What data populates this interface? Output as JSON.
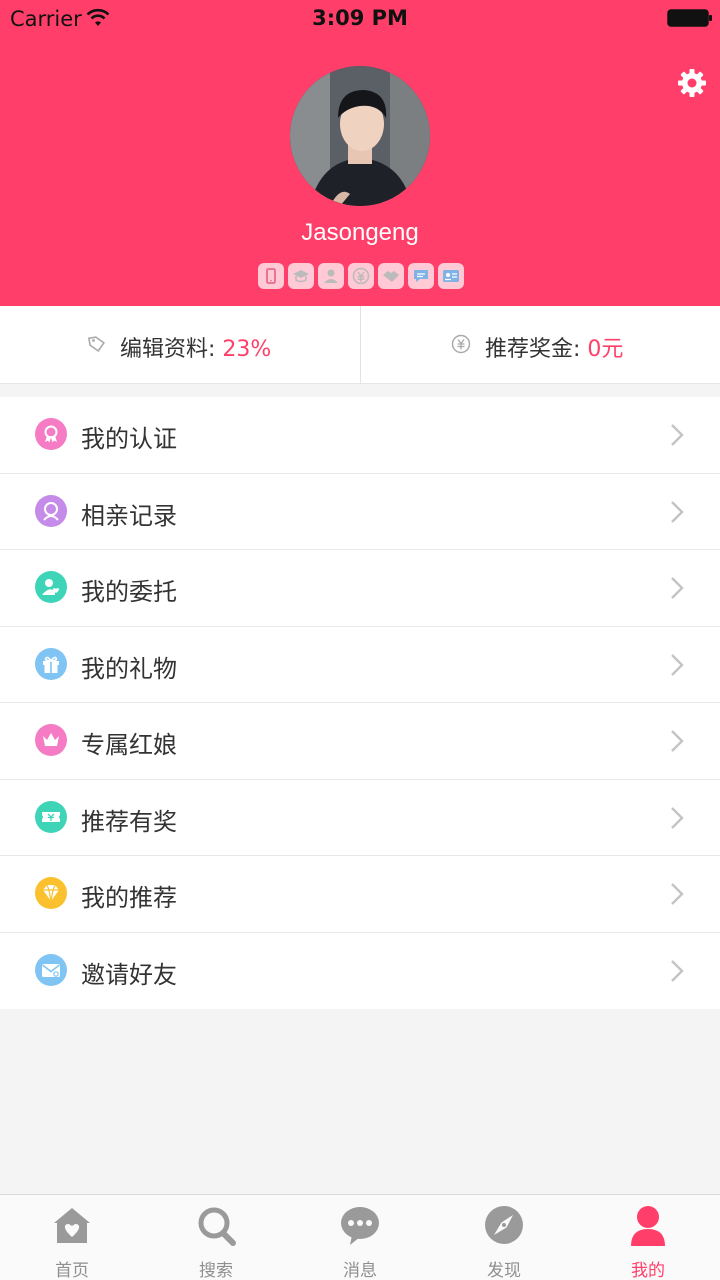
{
  "status_bar": {
    "carrier": "Carrier",
    "time": "3:09 PM"
  },
  "profile": {
    "username": "Jasongeng",
    "settings_icon": "gear-icon",
    "badges": [
      "phone-icon",
      "education-icon",
      "id-icon",
      "income-icon",
      "handshake-icon",
      "chat-icon",
      "card-icon"
    ]
  },
  "stats": [
    {
      "icon": "tag-icon",
      "label": "编辑资料: ",
      "value": "23%"
    },
    {
      "icon": "yen-icon",
      "label": "推荐奖金: ",
      "value": "0元"
    }
  ],
  "menu": [
    {
      "label": "我的认证",
      "icon": "ribbon-icon",
      "color": "#f57cc4"
    },
    {
      "label": "相亲记录",
      "icon": "person-icon",
      "color": "#c58be8"
    },
    {
      "label": "我的委托",
      "icon": "user-heart-icon",
      "color": "#3dd4b8"
    },
    {
      "label": "我的礼物",
      "icon": "gift-icon",
      "color": "#7fc4f3"
    },
    {
      "label": "专属红娘",
      "icon": "crown-icon",
      "color": "#f57cc4"
    },
    {
      "label": "推荐有奖",
      "icon": "ticket-icon",
      "color": "#3dd4b8"
    },
    {
      "label": "我的推荐",
      "icon": "diamond-icon",
      "color": "#fbc02d"
    },
    {
      "label": "邀请好友",
      "icon": "mail-icon",
      "color": "#7fc4f3"
    }
  ],
  "tabbar": [
    {
      "label": "首页",
      "icon": "home-icon",
      "active": false
    },
    {
      "label": "搜索",
      "icon": "search-icon",
      "active": false
    },
    {
      "label": "消息",
      "icon": "message-icon",
      "active": false
    },
    {
      "label": "发现",
      "icon": "compass-icon",
      "active": false
    },
    {
      "label": "我的",
      "icon": "profile-icon",
      "active": true
    }
  ],
  "colors": {
    "brand": "#ff3f69",
    "inactive": "#8f8f8f",
    "background": "#f4f4f4"
  }
}
